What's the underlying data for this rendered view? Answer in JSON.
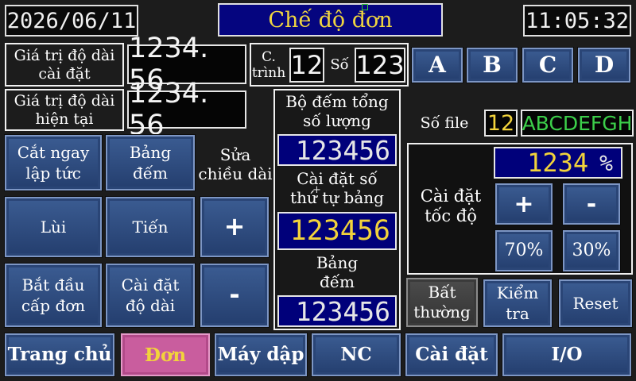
{
  "header": {
    "date": "2026/06/11",
    "title": "Chế độ đơn",
    "time": "11:05:32"
  },
  "length": {
    "set_label": "Giá trị độ dài\ncài đặt",
    "set_value": "1234. 56",
    "current_label": "Giá trị độ dài\nhiện tại",
    "current_value": "1234. 56"
  },
  "program": {
    "label": "C.\ntrình",
    "value": "12",
    "number_label": "Số",
    "number_value": "123"
  },
  "mode_buttons": [
    "A",
    "B",
    "C",
    "D"
  ],
  "counter": {
    "total_label": "Bộ đếm tổng\nsố lượng",
    "total_value": "123456",
    "seq_label": "Cài đặt số\nthứ tự bảng",
    "seq_value": "123456",
    "board_label": "Bảng\nđếm",
    "board_value": "123456"
  },
  "file": {
    "label": "Số file",
    "number": "12",
    "name": "ABCDEFGH"
  },
  "left_buttons": {
    "cut_now": "Cắt ngay\nlập tức",
    "board_count": "Bảng\nđếm",
    "edit_length_label": "Sửa\nchiều dài",
    "back": "Lùi",
    "forward": "Tiến",
    "plus": "+",
    "start_feed": "Bắt đầu\ncấp đơn",
    "set_length": "Cài đặt\nđộ dài",
    "minus": "-"
  },
  "speed": {
    "label": "Cài đặt\ntốc độ",
    "value": "1234",
    "unit": "%",
    "plus": "+",
    "minus": "-",
    "preset_high": "70%",
    "preset_low": "30%"
  },
  "status_buttons": {
    "abnormal": "Bất\nthường",
    "check": "Kiểm\ntra",
    "reset": "Reset"
  },
  "nav": [
    "Trang chủ",
    "Đơn",
    "Máy dập",
    "NC",
    "Cài đặt",
    "I/O"
  ],
  "colors": {
    "active_nav": "#c95d9e",
    "title_bg": "#05057f",
    "file_number": "#f2d33b",
    "file_name": "#3ccf4a"
  }
}
